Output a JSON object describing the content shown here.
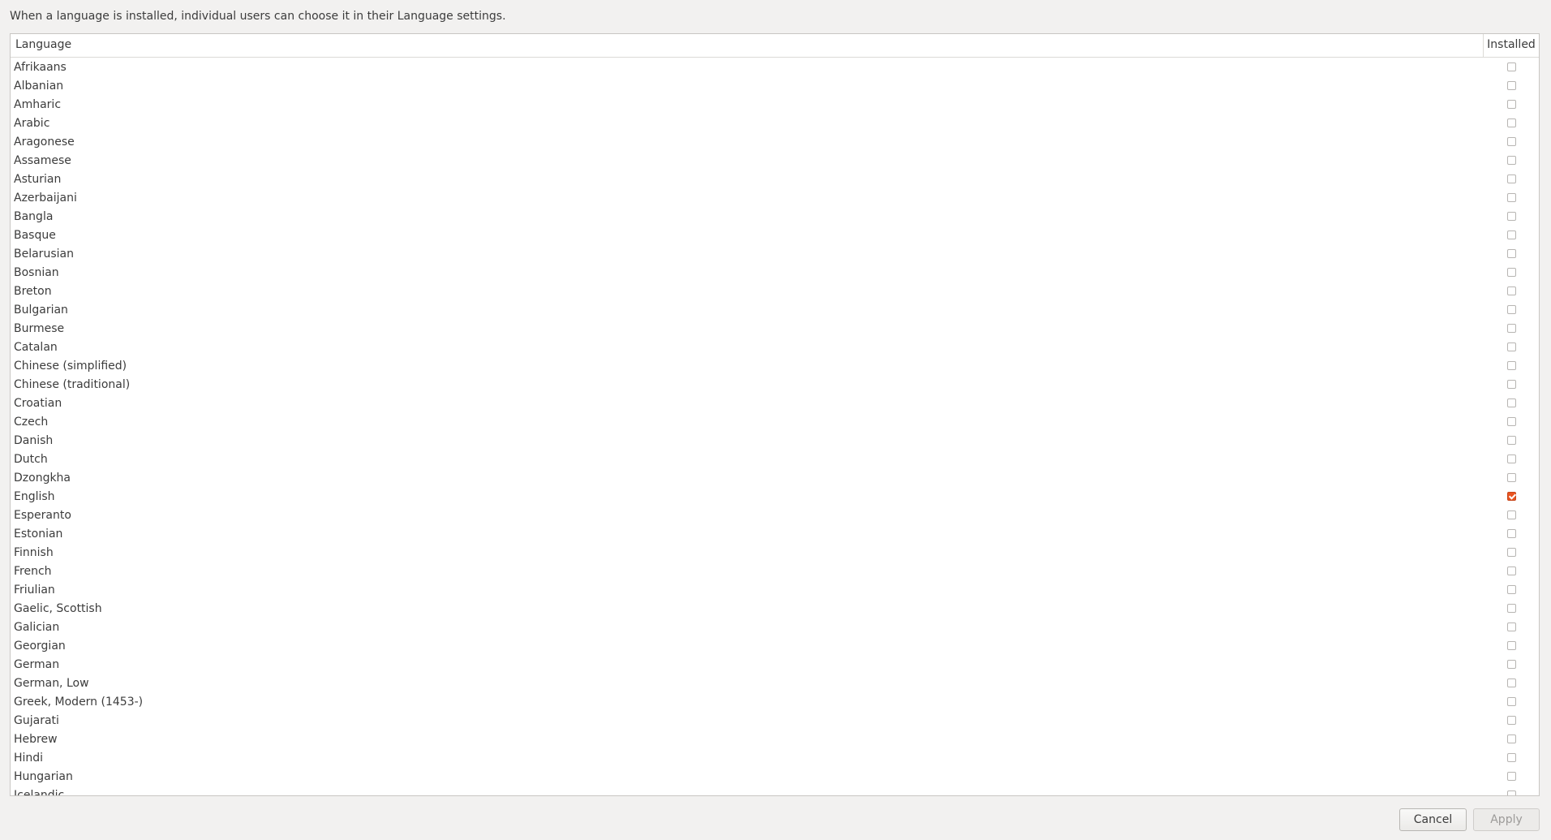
{
  "description": "When a language is installed, individual users can choose it in their Language settings.",
  "table": {
    "col_language": "Language",
    "col_installed": "Installed",
    "rows": [
      {
        "name": "Afrikaans",
        "installed": false
      },
      {
        "name": "Albanian",
        "installed": false
      },
      {
        "name": "Amharic",
        "installed": false
      },
      {
        "name": "Arabic",
        "installed": false
      },
      {
        "name": "Aragonese",
        "installed": false
      },
      {
        "name": "Assamese",
        "installed": false
      },
      {
        "name": "Asturian",
        "installed": false
      },
      {
        "name": "Azerbaijani",
        "installed": false
      },
      {
        "name": "Bangla",
        "installed": false
      },
      {
        "name": "Basque",
        "installed": false
      },
      {
        "name": "Belarusian",
        "installed": false
      },
      {
        "name": "Bosnian",
        "installed": false
      },
      {
        "name": "Breton",
        "installed": false
      },
      {
        "name": "Bulgarian",
        "installed": false
      },
      {
        "name": "Burmese",
        "installed": false
      },
      {
        "name": "Catalan",
        "installed": false
      },
      {
        "name": "Chinese (simplified)",
        "installed": false
      },
      {
        "name": "Chinese (traditional)",
        "installed": false
      },
      {
        "name": "Croatian",
        "installed": false
      },
      {
        "name": "Czech",
        "installed": false
      },
      {
        "name": "Danish",
        "installed": false
      },
      {
        "name": "Dutch",
        "installed": false
      },
      {
        "name": "Dzongkha",
        "installed": false
      },
      {
        "name": "English",
        "installed": true
      },
      {
        "name": "Esperanto",
        "installed": false
      },
      {
        "name": "Estonian",
        "installed": false
      },
      {
        "name": "Finnish",
        "installed": false
      },
      {
        "name": "French",
        "installed": false
      },
      {
        "name": "Friulian",
        "installed": false
      },
      {
        "name": "Gaelic, Scottish",
        "installed": false
      },
      {
        "name": "Galician",
        "installed": false
      },
      {
        "name": "Georgian",
        "installed": false
      },
      {
        "name": "German",
        "installed": false
      },
      {
        "name": "German, Low",
        "installed": false
      },
      {
        "name": "Greek, Modern (1453-)",
        "installed": false
      },
      {
        "name": "Gujarati",
        "installed": false
      },
      {
        "name": "Hebrew",
        "installed": false
      },
      {
        "name": "Hindi",
        "installed": false
      },
      {
        "name": "Hungarian",
        "installed": false
      },
      {
        "name": "Icelandic",
        "installed": false
      }
    ]
  },
  "buttons": {
    "cancel": "Cancel",
    "apply": "Apply"
  },
  "colors": {
    "accent": "#e95420"
  }
}
